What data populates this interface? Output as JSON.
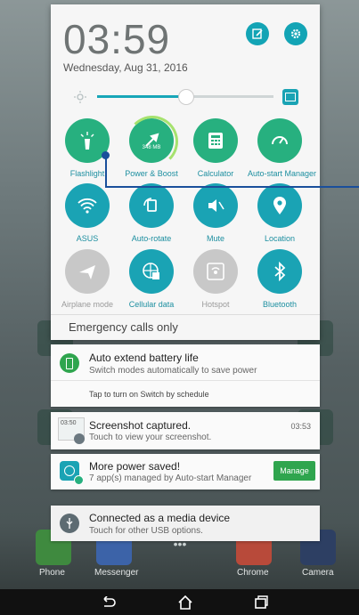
{
  "status": {
    "time": "03:59",
    "date": "Wednesday, Aug 31, 2016"
  },
  "header_icons": [
    "edit-icon",
    "settings-icon"
  ],
  "brightness": {
    "level": 0.5,
    "auto_icon": "auto-brightness-icon"
  },
  "tiles": [
    {
      "label": "Flashlight",
      "icon": "flashlight-icon",
      "state": "green"
    },
    {
      "label": "Power & Boost",
      "icon": "boost-icon",
      "state": "green",
      "badge": "348 MB"
    },
    {
      "label": "Calculator",
      "icon": "calculator-icon",
      "state": "green"
    },
    {
      "label": "Auto-start Manager",
      "icon": "speedometer-icon",
      "state": "green"
    },
    {
      "label": "ASUS",
      "icon": "wifi-icon",
      "state": "on"
    },
    {
      "label": "Auto-rotate",
      "icon": "rotate-icon",
      "state": "on"
    },
    {
      "label": "Mute",
      "icon": "mute-icon",
      "state": "on"
    },
    {
      "label": "Location",
      "icon": "location-icon",
      "state": "on"
    },
    {
      "label": "Airplane mode",
      "icon": "airplane-icon",
      "state": "off"
    },
    {
      "label": "Cellular data",
      "icon": "cellular-icon",
      "state": "on"
    },
    {
      "label": "Hotspot",
      "icon": "hotspot-icon",
      "state": "off"
    },
    {
      "label": "Bluetooth",
      "icon": "bluetooth-icon",
      "state": "on"
    }
  ],
  "emergency": "Emergency calls only",
  "notifications": {
    "battery": {
      "title": "Auto extend battery life",
      "subtitle": "Switch modes automatically to save power",
      "action": "Tap to turn on Switch by schedule"
    },
    "screenshot": {
      "title": "Screenshot captured.",
      "subtitle": "Touch to view your screenshot.",
      "time": "03:53",
      "thumb_text": "03:50"
    },
    "power": {
      "title": "More power saved!",
      "subtitle": "7 app(s) managed by Auto-start Manager",
      "button": "Manage"
    },
    "usb": {
      "title": "Connected as a media device",
      "subtitle": "Touch for other USB options."
    }
  },
  "dock": [
    "Phone",
    "Messenger",
    "Chrome",
    "Camera"
  ],
  "colors": {
    "accent": "#1aa3b4",
    "green": "#27b07f",
    "off": "#c8c8c8"
  }
}
